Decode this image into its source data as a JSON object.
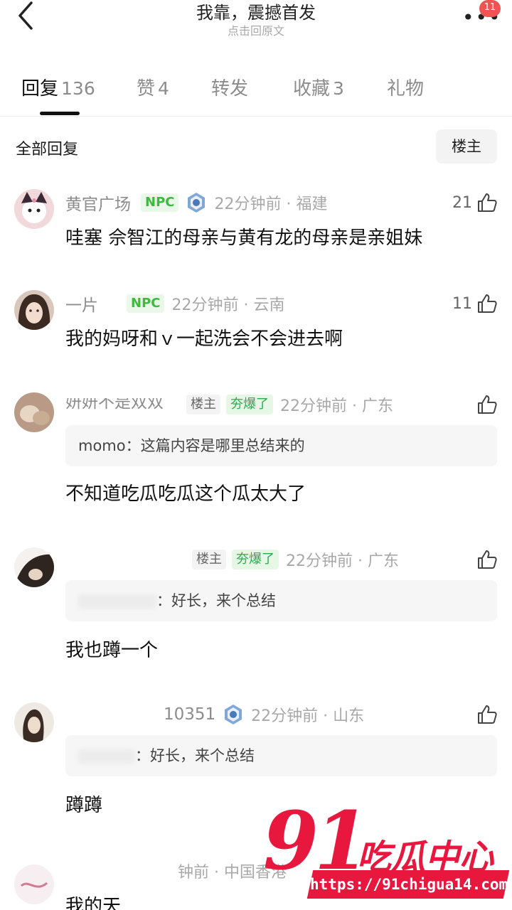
{
  "header": {
    "title": "我靠，震撼首发",
    "subtitle": "点击回原文",
    "notification_count": "11"
  },
  "tabs": [
    {
      "label": "回复",
      "count": "136",
      "active": true
    },
    {
      "label": "赞",
      "count": "4"
    },
    {
      "label": "转发",
      "count": ""
    },
    {
      "label": "收藏",
      "count": "3"
    },
    {
      "label": "礼物",
      "count": ""
    }
  ],
  "filter": {
    "title": "全部回复",
    "op_button": "楼主"
  },
  "comments": [
    {
      "username": "黄官广场",
      "badge": "NPC",
      "time": "22分钟前 · 福建",
      "likes": "21",
      "text": "哇塞 佘智江的母亲与黄有龙的母亲是亲姐妹"
    },
    {
      "username": "一片",
      "badge": "NPC",
      "time": "22分钟前 · 云南",
      "likes": "11",
      "text": "我的妈呀和ｖ一起洗会不会进去啊"
    },
    {
      "username": "妍妍不是双双",
      "op_badge": "楼主",
      "hot_badge": "夯爆了",
      "time": "22分钟前 · 广东",
      "quote_user": "momo",
      "quote_text": "这篇内容是哪里总结来的",
      "text": "不知道吃瓜吃瓜这个瓜太大了"
    },
    {
      "op_badge": "楼主",
      "hot_badge": "夯爆了",
      "time": "22分钟前 · 广东",
      "quote_text": "好长，来个总结",
      "text": "我也蹲一个"
    },
    {
      "username": "10351",
      "time": "22分钟前 · 山东",
      "quote_text": "好长，来个总结",
      "text": "蹲蹲"
    },
    {
      "time": "钟前 · 中国香港",
      "text": "我的天"
    }
  ],
  "watermark": {
    "number": "91",
    "brand": "吃瓜中心",
    "url": "https://91chigua14.com"
  },
  "colors": {
    "npc_green": "#3fb83f",
    "hot_green": "#2fa84f",
    "badge_red": "#f25252",
    "watermark_red": "#e8173d"
  },
  "icons": [
    "back-arrow-icon",
    "more-icon",
    "thumbs-up-icon",
    "medal-icon"
  ]
}
